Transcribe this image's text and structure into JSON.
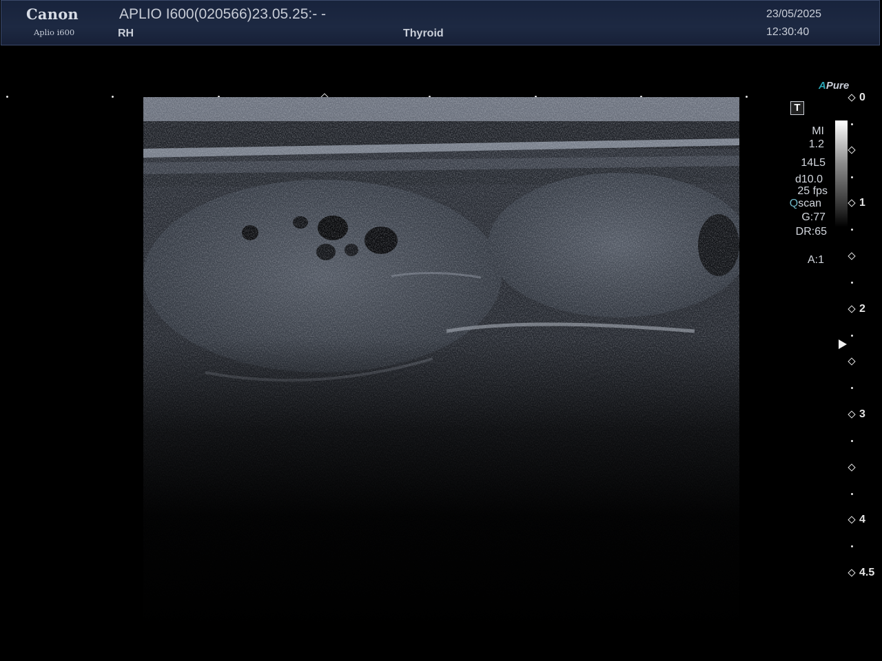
{
  "header": {
    "brand": "Canon",
    "model": "Aplio i600",
    "title": "APLIO I600(020566)23.05.25:- -",
    "side": "RH",
    "preset": "Thyroid",
    "date": "23/05/2025",
    "time": "12:30:40"
  },
  "panel": {
    "apure_a": "A",
    "apure_word": "Pure",
    "t_icon": "T",
    "mi_label": "MI",
    "mi_value": "1.2",
    "probe": "14L5",
    "depth": "d10.0",
    "fps": "25 fps",
    "qscan_q": "Q",
    "qscan_rest": "scan",
    "gain": "G:77",
    "dr": "DR:65",
    "acoustic": "A:1"
  },
  "ruler": {
    "labels": [
      "0",
      "1",
      "2",
      "3",
      "4",
      "4.5"
    ]
  },
  "colors": {
    "header_bg": "#1d2942",
    "accent_apure": "#2aa7b8",
    "text": "#c9ced8"
  },
  "icons": [
    "t-icon",
    "focus-marker-icon",
    "depth-diamond-icon"
  ]
}
